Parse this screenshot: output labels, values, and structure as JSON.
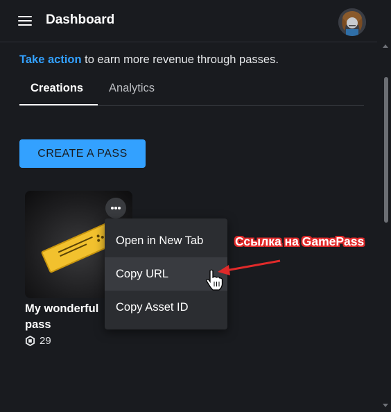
{
  "header": {
    "title": "Dashboard"
  },
  "promo": {
    "link_text": "Take action",
    "rest_text": " to earn more revenue through passes."
  },
  "tabs": [
    {
      "label": "Creations",
      "active": true
    },
    {
      "label": "Analytics",
      "active": false
    }
  ],
  "create_button": {
    "label": "CREATE A PASS"
  },
  "pass": {
    "name": "My wonderful pass",
    "price": "29"
  },
  "context_menu": {
    "items": [
      {
        "label": "Open in New Tab"
      },
      {
        "label": "Copy URL",
        "hovered": true
      },
      {
        "label": "Copy Asset ID"
      }
    ]
  },
  "annotation": {
    "text": "Ссылка на GamePass",
    "color": "#e02a2a"
  },
  "colors": {
    "background": "#191b1f",
    "accent": "#33a1ff",
    "menu": "#2b2d31"
  },
  "icons": [
    "hamburger-menu-icon",
    "avatar",
    "more-options-icon",
    "robux-icon",
    "pointer-cursor-icon",
    "arrow-annotation"
  ]
}
